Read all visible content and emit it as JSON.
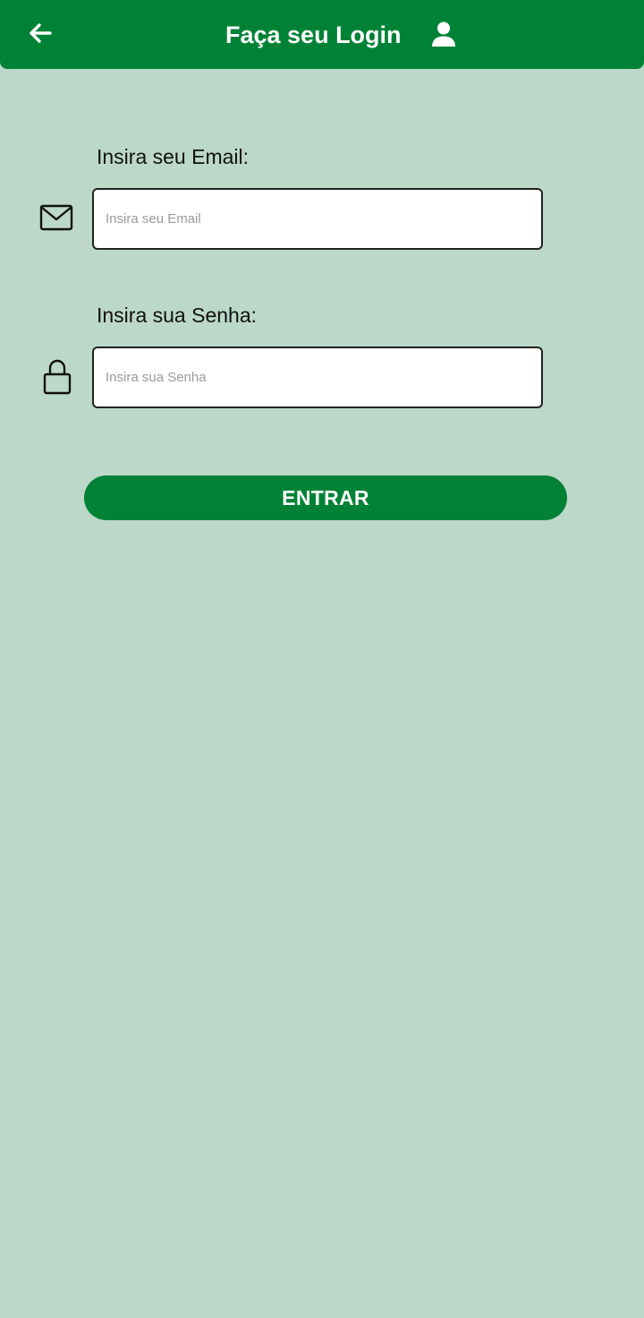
{
  "header": {
    "title": "Faça seu Login",
    "back_icon": "arrow-left-icon",
    "user_icon": "user-icon"
  },
  "form": {
    "email": {
      "label": "Insira seu Email:",
      "placeholder": "Insira seu Email",
      "value": "",
      "icon": "mail-icon"
    },
    "password": {
      "label": "Insira sua Senha:",
      "placeholder": "Insira sua Senha",
      "value": "",
      "icon": "lock-icon"
    },
    "submit_label": "ENTRAR"
  },
  "colors": {
    "primary": "#008236",
    "background": "#bcd8c8",
    "input_background": "#ffffff",
    "input_border": "#222222"
  }
}
